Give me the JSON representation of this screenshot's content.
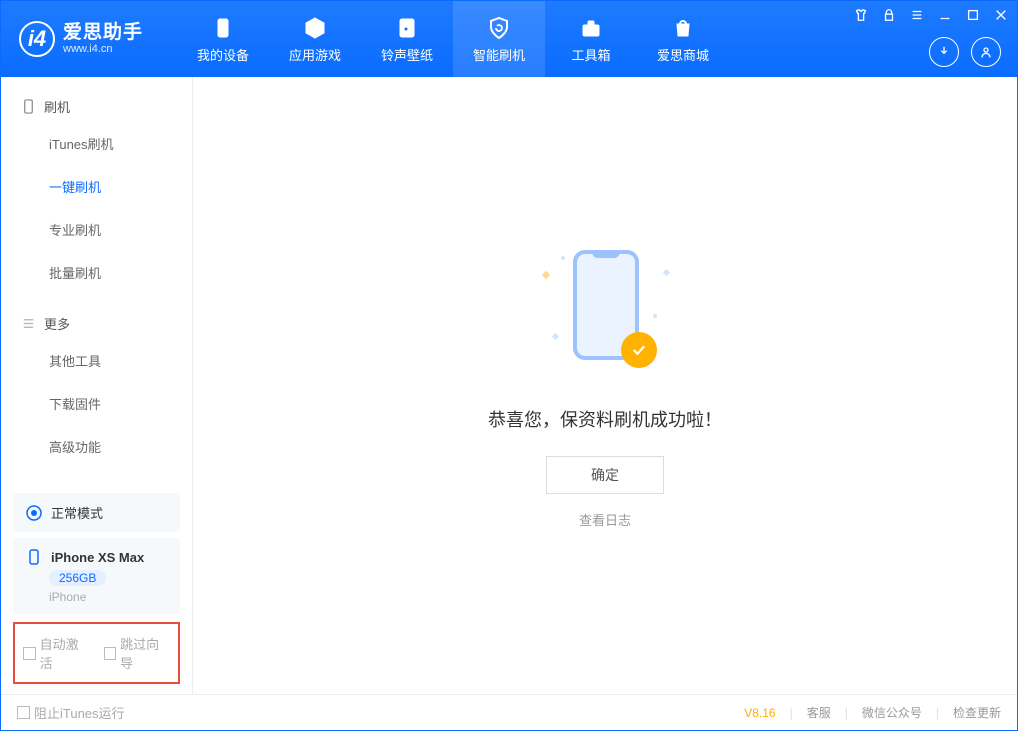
{
  "app": {
    "name_cn": "爱思助手",
    "name_en": "www.i4.cn"
  },
  "nav": [
    {
      "label": "我的设备"
    },
    {
      "label": "应用游戏"
    },
    {
      "label": "铃声壁纸"
    },
    {
      "label": "智能刷机"
    },
    {
      "label": "工具箱"
    },
    {
      "label": "爱思商城"
    }
  ],
  "sidebar": {
    "section1": {
      "title": "刷机",
      "items": [
        "iTunes刷机",
        "一键刷机",
        "专业刷机",
        "批量刷机"
      ],
      "active_index": 1
    },
    "section2": {
      "title": "更多",
      "items": [
        "其他工具",
        "下载固件",
        "高级功能"
      ]
    }
  },
  "device": {
    "mode": "正常模式",
    "name": "iPhone XS Max",
    "storage": "256GB",
    "type": "iPhone"
  },
  "bottom_checks": {
    "auto_activate": "自动激活",
    "skip_guide": "跳过向导"
  },
  "main": {
    "success_text": "恭喜您，保资料刷机成功啦！",
    "ok_button": "确定",
    "view_log": "查看日志"
  },
  "footer": {
    "block_itunes": "阻止iTunes运行",
    "version": "V8.16",
    "support": "客服",
    "wechat": "微信公众号",
    "update": "检查更新"
  }
}
